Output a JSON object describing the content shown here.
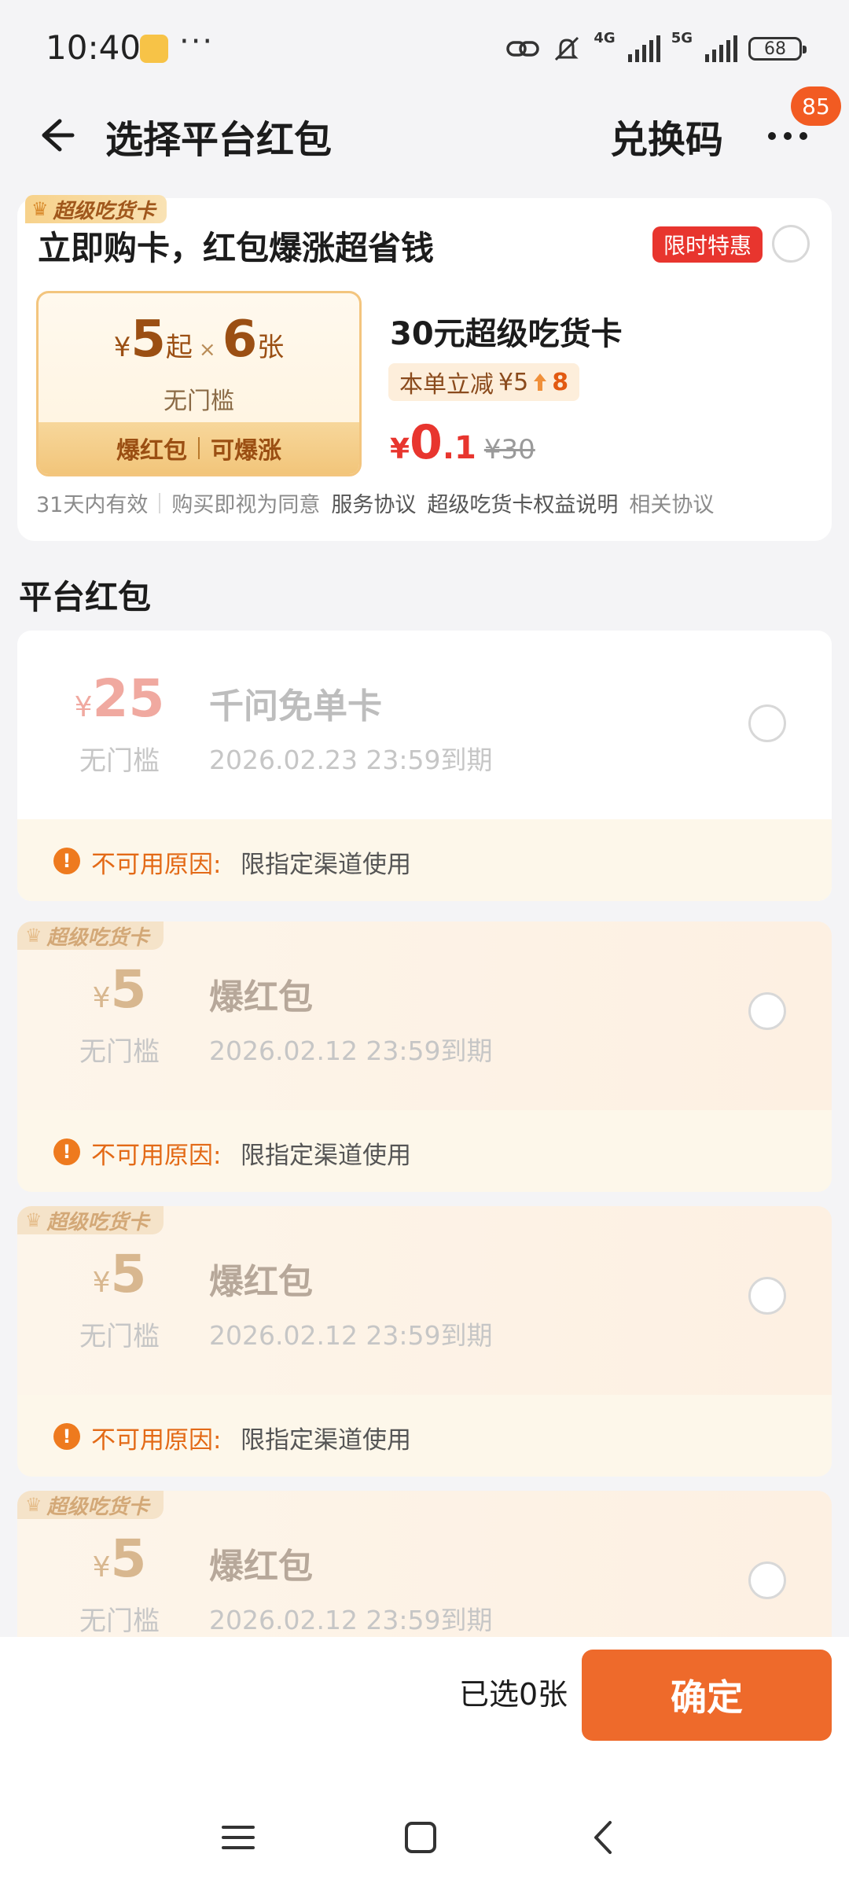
{
  "status_bar": {
    "time": "10:40",
    "dots": "···",
    "net_4g": "4G",
    "net_5g": "5G",
    "battery": "68"
  },
  "header": {
    "title": "选择平台红包",
    "exchange_label": "兑换码",
    "more_badge": "85"
  },
  "promo_card": {
    "headline": "立即购卡，红包爆涨超省钱",
    "limited_tag": "限时特惠",
    "super_label": "超级吃货卡",
    "amount_currency": "¥",
    "amount_value": "5",
    "amount_from": "起",
    "times": "×",
    "count_value": "6",
    "count_unit": "张",
    "threshold": "无门槛",
    "feature_1": "爆红包",
    "feature_2": "可爆涨",
    "card_name": "30元超级吃货卡",
    "reduce_text": "本单立减",
    "reduce_from": "¥5",
    "reduce_to": "8",
    "price_currency": "¥",
    "price_int": "0",
    "price_dec": ".1",
    "price_original": "¥30",
    "validity": "31天内有效",
    "agree_text": "购买即视为同意",
    "link_service": "服务协议",
    "link_rights": "超级吃货卡权益说明",
    "link_related": "相关协议"
  },
  "section_title": "平台红包",
  "coupons": [
    {
      "currency": "¥",
      "amount": "25",
      "threshold": "无门槛",
      "name": "千问免单卡",
      "expiry": "2026.02.23 23:59到期",
      "reason_label": "不可用原因:",
      "reason": "限指定渠道使用"
    },
    {
      "super_tag": "超级吃货卡",
      "currency": "¥",
      "amount": "5",
      "threshold": "无门槛",
      "name": "爆红包",
      "expiry": "2026.02.12 23:59到期",
      "reason_label": "不可用原因:",
      "reason": "限指定渠道使用"
    },
    {
      "super_tag": "超级吃货卡",
      "currency": "¥",
      "amount": "5",
      "threshold": "无门槛",
      "name": "爆红包",
      "expiry": "2026.02.12 23:59到期",
      "reason_label": "不可用原因:",
      "reason": "限指定渠道使用"
    },
    {
      "super_tag": "超级吃货卡",
      "currency": "¥",
      "amount": "5",
      "threshold": "无门槛",
      "name": "爆红包",
      "expiry": "2026.02.12 23:59到期"
    }
  ],
  "footer": {
    "selected_text": "已选0张",
    "confirm_label": "确定"
  },
  "colors": {
    "accent": "#ee6a2b",
    "price_red": "#e8352e",
    "gold": "#9b4f13"
  },
  "icons": [
    "back-arrow-icon",
    "more-icon",
    "warning-icon",
    "crown-icon",
    "menu-icon",
    "home-icon",
    "back-nav-icon"
  ]
}
